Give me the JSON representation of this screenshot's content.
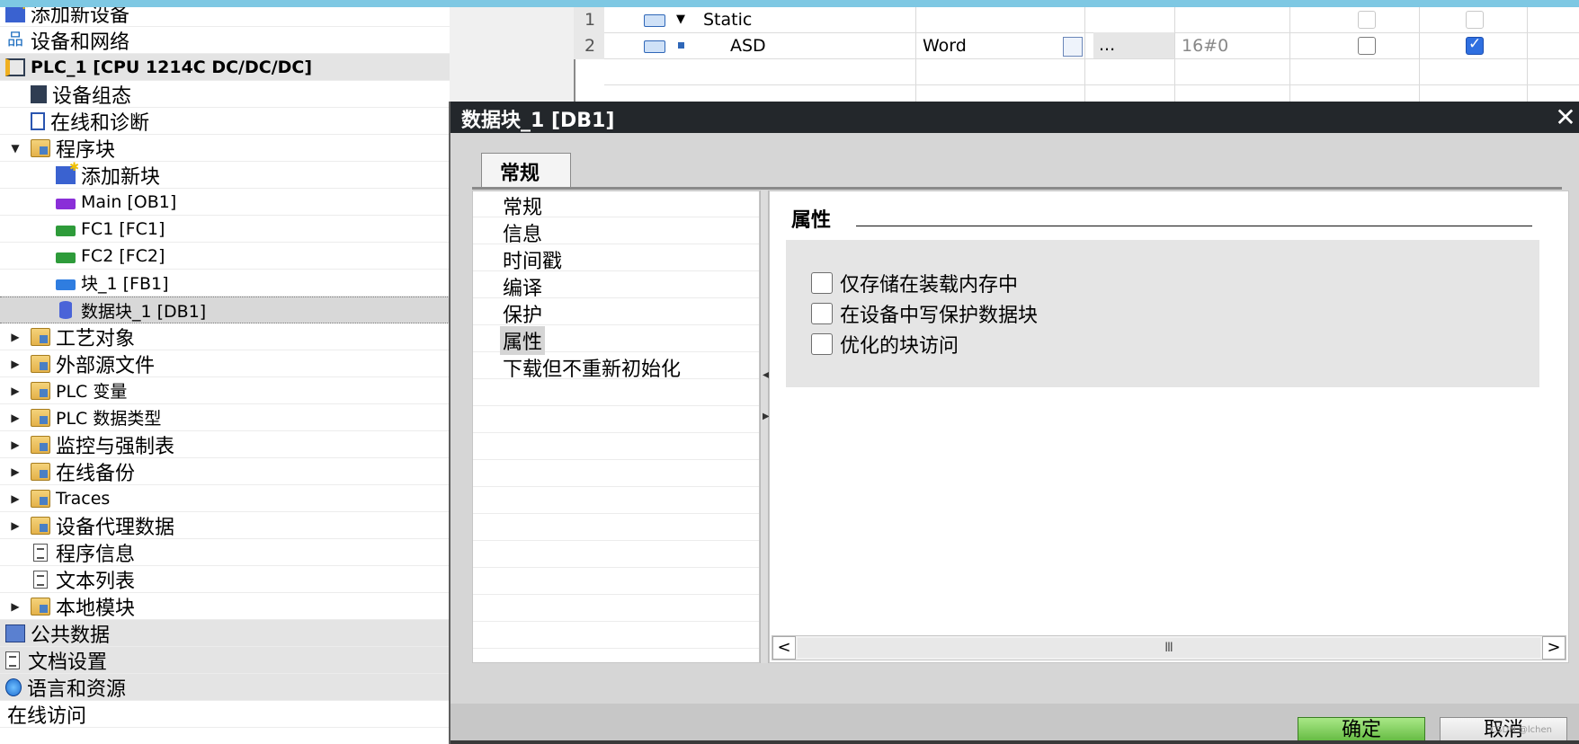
{
  "tree": {
    "items": [
      {
        "label": "添加新设备"
      },
      {
        "label": "设备和网络"
      },
      {
        "label": "PLC_1 [CPU 1214C DC/DC/DC]"
      },
      {
        "label": "设备组态"
      },
      {
        "label": "在线和诊断"
      },
      {
        "label": "程序块"
      },
      {
        "label": "添加新块"
      },
      {
        "label": "Main [OB1]"
      },
      {
        "label": "FC1 [FC1]"
      },
      {
        "label": "FC2 [FC2]"
      },
      {
        "label": "块_1 [FB1]"
      },
      {
        "label": "数据块_1 [DB1]"
      },
      {
        "label": "工艺对象"
      },
      {
        "label": "外部源文件"
      },
      {
        "label": "PLC 变量"
      },
      {
        "label": "PLC 数据类型"
      },
      {
        "label": "监控与强制表"
      },
      {
        "label": "在线备份"
      },
      {
        "label": "Traces"
      },
      {
        "label": "设备代理数据"
      },
      {
        "label": "程序信息"
      },
      {
        "label": "文本列表"
      },
      {
        "label": "本地模块"
      },
      {
        "label": "公共数据"
      },
      {
        "label": "文档设置"
      },
      {
        "label": "语言和资源"
      },
      {
        "label": "在线访问"
      }
    ]
  },
  "table": {
    "rows": [
      {
        "num": "1",
        "name": "Static",
        "type": "",
        "ellipsis": "",
        "default": "",
        "chk1": false,
        "chk2": false
      },
      {
        "num": "2",
        "name": "ASD",
        "type": "Word",
        "ellipsis": "...",
        "default": "16#0",
        "chk1": false,
        "chk2": true
      }
    ]
  },
  "dialog": {
    "title": "数据块_1 [DB1]",
    "close_glyph": "✕",
    "tab": "常规",
    "nav": [
      "常规",
      "信息",
      "时间戳",
      "编译",
      "保护",
      "属性",
      "下载但不重新初始化"
    ],
    "active_nav": "属性",
    "section_title": "属性",
    "options": [
      {
        "label": "仅存储在装载内存中",
        "checked": false
      },
      {
        "label": "在设备中写保护数据块",
        "checked": false
      },
      {
        "label": "优化的块访问",
        "checked": false
      }
    ],
    "scroll": {
      "left": "<",
      "right": ">",
      "thumb": "Ⅲ"
    },
    "ok_label": "确定",
    "cancel_label": "取消"
  },
  "watermark": "CSDN @lchen",
  "colors": {
    "titlebar": "#23272b",
    "ok_button": "#5fb73c",
    "accent_strip": "#7ec8e3"
  }
}
